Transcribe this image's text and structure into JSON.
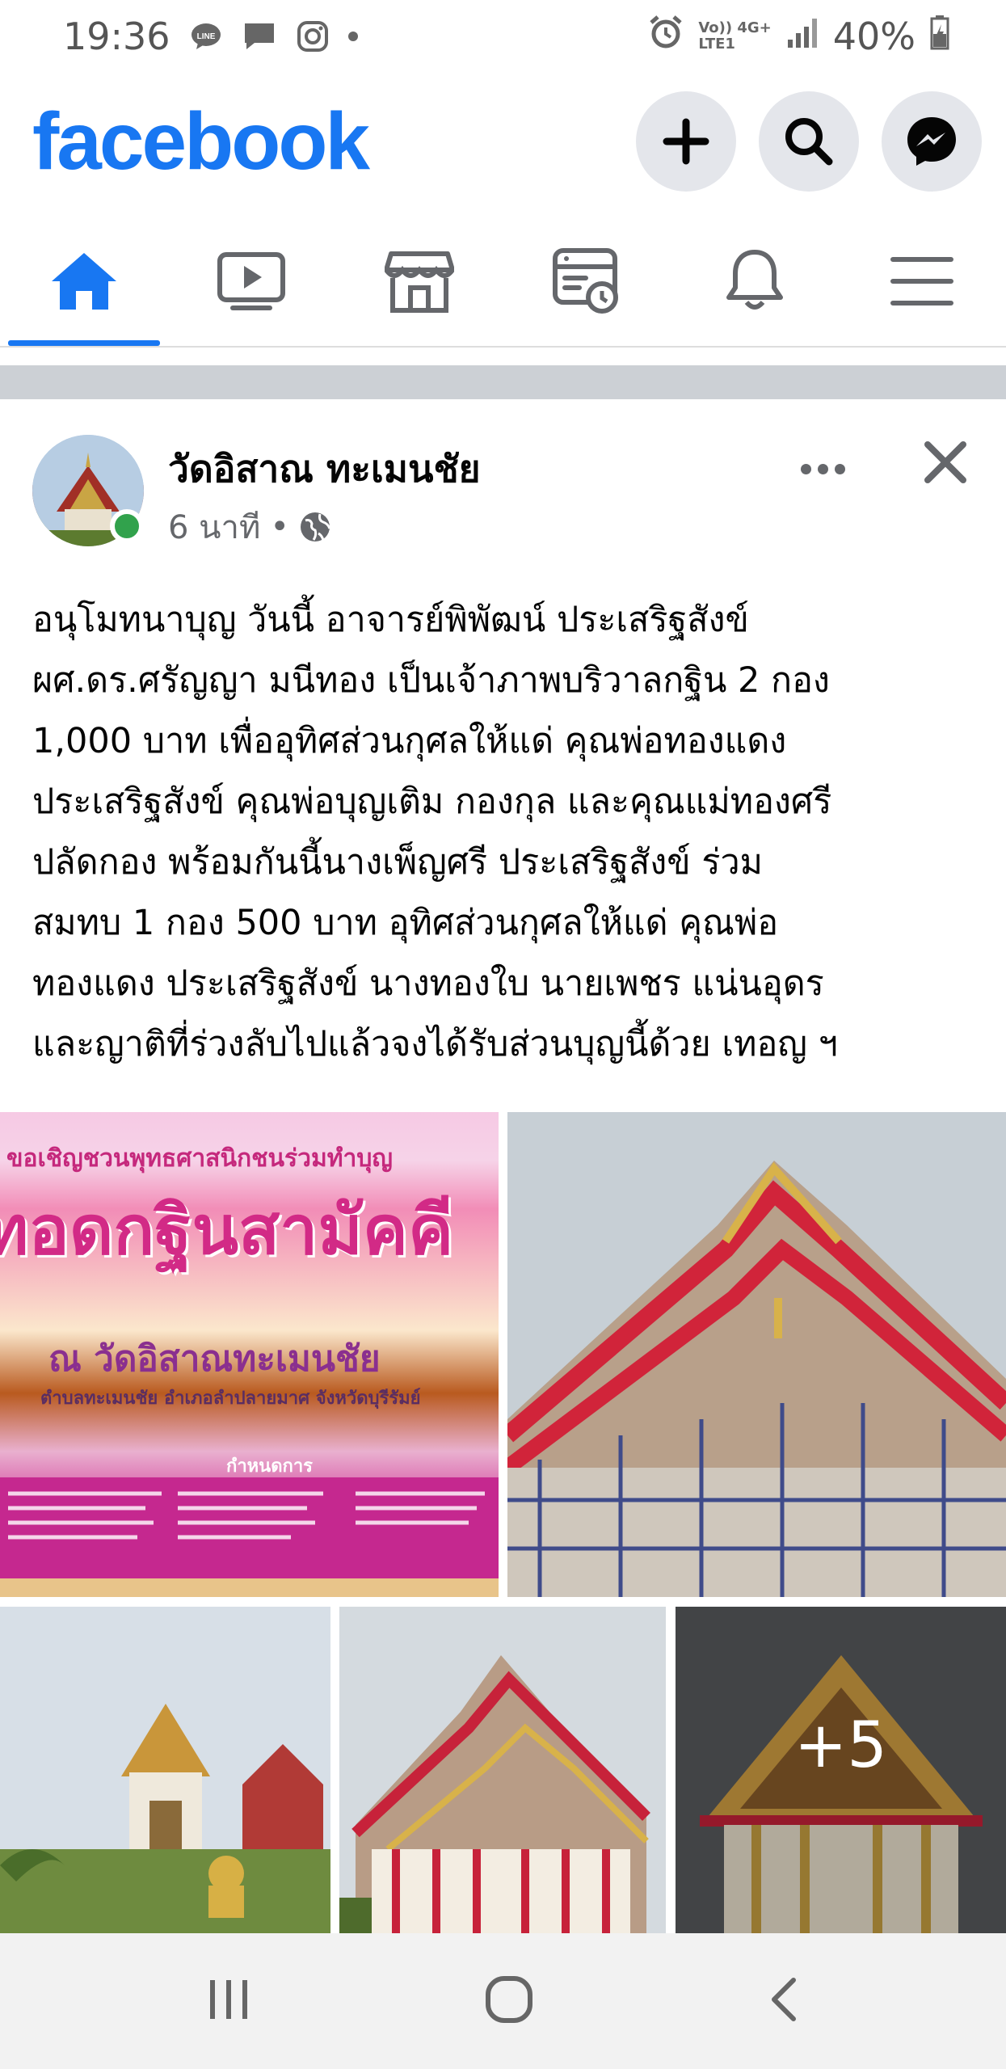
{
  "status_bar": {
    "time": "19:36",
    "network_line1": "Vo)) 4G+",
    "network_line2": "LTE1",
    "battery": "40%"
  },
  "header": {
    "logo": "facebook",
    "actions": [
      "plus-icon",
      "search-icon",
      "messenger-icon"
    ]
  },
  "nav_tabs": [
    {
      "icon": "home-icon",
      "active": true
    },
    {
      "icon": "watch-video-icon",
      "active": false
    },
    {
      "icon": "marketplace-icon",
      "active": false
    },
    {
      "icon": "news-feed-icon",
      "active": false
    },
    {
      "icon": "notifications-bell-icon",
      "active": false
    },
    {
      "icon": "menu-icon",
      "active": false
    }
  ],
  "post": {
    "author": "วัดอิสาณ ทะเมนชัย",
    "time": "6 นาที",
    "separator": "•",
    "privacy_icon": "globe-icon",
    "text_lines": [
      "อนุโมทนาบุญ วันนี้ อาจารย์พิพัฒน์ ประเสริฐสังข์",
      "ผศ.ดร.ศรัญญา มนีทอง เป็นเจ้าภาพบริวาลกฐิน 2 กอง",
      "1,000 บาท เพื่ออุทิศส่วนกุศลให้แด่ คุณพ่อทองแดง",
      "ประเสริฐสังข์ คุณพ่อบุญเติม กองกุล และคุณแม่ทองศรี",
      "ปลัดกอง พร้อมกันนี้นางเพ็ญศรี ประเสริฐสังข์ ร่วม",
      "สมทบ 1 กอง 500 บาท อุทิศส่วนกุศลให้แด่ คุณพ่อ",
      "ทองแดง ประเสริฐสังข์ นางทองใบ นายเพชร แน่นอุดร",
      "และญาติที่ร่วงลับไปแล้วจงได้รับส่วนบุญนี้ด้วย เทอญ ฯ"
    ],
    "banner": {
      "line1": "ขอเชิญชวนพุทธศาสนิกชนร่วมทำบุญ",
      "line2": "ทอดกฐินสามัคคี",
      "line3": "ณ วัดอิสาณทะเมนชัย",
      "line4": "ตำบลทะเมนชัย อำเภอลำปลายมาศ จังหวัดบุรีรัมย์",
      "line5": "กำหนดการ"
    },
    "more_photos": "+5"
  },
  "colors": {
    "brand": "#1877f2",
    "online": "#31a24c",
    "muted": "#65676b"
  }
}
